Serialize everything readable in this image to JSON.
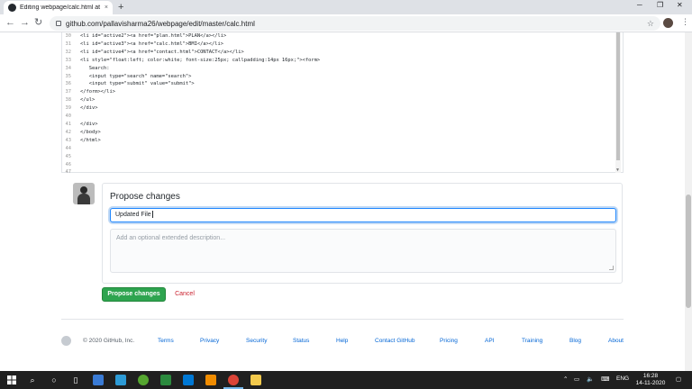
{
  "browser": {
    "tab_title": "Editing webpage/calc.html at m",
    "tab_close": "×",
    "new_tab": "+",
    "url": "github.com/pallavisharma26/webpage/edit/master/calc.html",
    "win_min": "─",
    "win_max": "❐",
    "win_close": "✕"
  },
  "editor": {
    "lines": [
      {
        "n": "30",
        "code": "<li id=\"active2\"><a href=\"plan.html\">PLAN</a></li>"
      },
      {
        "n": "31",
        "code": "<li id=\"active3\"><a href=\"calc.html\">BMI</a></li>"
      },
      {
        "n": "32",
        "code": "<li id=\"active4\"><a href=\"contact.html\">CONTACT</a></li>"
      },
      {
        "n": "33",
        "code": "<li style=\"float:left; color:white; font-size:25px; callpadding:14px 16px;\"><form>"
      },
      {
        "n": "34",
        "code": "   Search:"
      },
      {
        "n": "35",
        "code": "   <input type=\"search\" name=\"search\">"
      },
      {
        "n": "36",
        "code": "   <input type=\"submit\" value=\"submit\">"
      },
      {
        "n": "37",
        "code": "</form></li>"
      },
      {
        "n": "38",
        "code": "</ul>"
      },
      {
        "n": "39",
        "code": "</div>"
      },
      {
        "n": "40",
        "code": ""
      },
      {
        "n": "41",
        "code": "</div>"
      },
      {
        "n": "42",
        "code": "</body>"
      },
      {
        "n": "43",
        "code": "</html>"
      },
      {
        "n": "44",
        "code": ""
      },
      {
        "n": "45",
        "code": ""
      },
      {
        "n": "46",
        "code": ""
      },
      {
        "n": "47",
        "code": ""
      }
    ]
  },
  "propose": {
    "heading": "Propose changes",
    "summary_value": "Updated File",
    "description_placeholder": "Add an optional extended description...",
    "submit_label": "Propose changes",
    "cancel_label": "Cancel"
  },
  "footer": {
    "copyright": "© 2020 GitHub, Inc.",
    "links": [
      "Terms",
      "Privacy",
      "Security",
      "Status",
      "Help",
      "Contact GitHub",
      "Pricing",
      "API",
      "Training",
      "Blog",
      "About"
    ]
  },
  "taskbar": {
    "language": "ENG",
    "time": "16:28",
    "date": "14-11-2020"
  },
  "colors": {
    "primary_button": "#2ea44f",
    "cancel_text": "#cb2431",
    "link": "#0366d6",
    "focus_border": "#2188ff"
  }
}
